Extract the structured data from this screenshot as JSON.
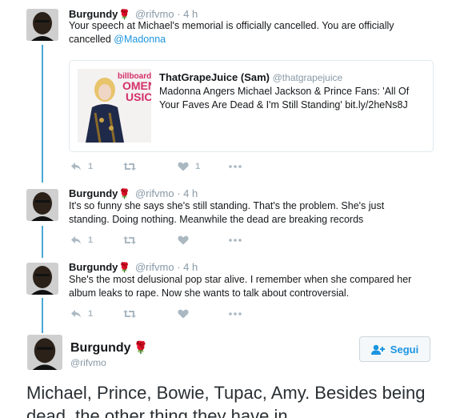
{
  "tweets": [
    {
      "name": "Burgundy",
      "handle": "@rifvmo",
      "time": "· 4 h",
      "text_before": "Your speech at Michael's memorial is officially cancelled. You are officially cancelled ",
      "mention": "@Madonna",
      "reply_count": "1",
      "retweet_count": "",
      "like_count": "1",
      "quote": {
        "name": "ThatGrapeJuice (Sam)",
        "handle": "@thatgrapejuice",
        "text": "Madonna Angers Michael Jackson & Prince Fans:  'All Of Your Faves Are Dead & I'm Still Standing' bit.ly/2heNs8J",
        "thumb_text": "billboard WOMEN MUSIC"
      }
    },
    {
      "name": "Burgundy",
      "handle": "@rifvmo",
      "time": "· 4 h",
      "text": "It's so funny she says she's still standing. That's the problem. She's just standing. Doing nothing. Meanwhile the dead are breaking records",
      "reply_count": "1",
      "retweet_count": "",
      "like_count": ""
    },
    {
      "name": "Burgundy",
      "handle": "@rifvmo",
      "time": "· 4 h",
      "text": "She's the most delusional pop star alive. I remember when she compared her album leaks to rape. Now she wants to talk about controversial.",
      "reply_count": "1",
      "retweet_count": "",
      "like_count": ""
    }
  ],
  "main_tweet": {
    "name": "Burgundy",
    "handle": "@rifvmo",
    "follow_label": "Segui",
    "text": "Michael, Prince, Bowie, Tupac, Amy. Besides being dead, the other thing they have in"
  },
  "icons": {
    "reply": "reply-icon",
    "retweet": "retweet-icon",
    "like": "heart-icon",
    "more": "more-icon",
    "rose": "rose-icon",
    "follow": "add-user-icon"
  },
  "colors": {
    "thread_line": "#4aa8d8",
    "link": "#1b95e0",
    "muted": "#8899a6",
    "rose": "#c0162c"
  }
}
